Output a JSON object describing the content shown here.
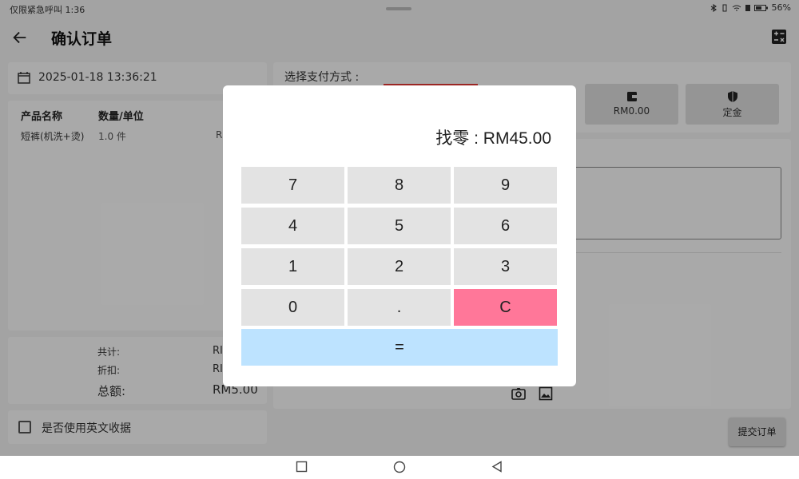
{
  "status_bar": {
    "left_text": "仅限紧急呼叫 1:36",
    "battery": "56%"
  },
  "app_bar": {
    "title": "确认订单",
    "icons": [
      "back-arrow-icon",
      "calculator-icon"
    ]
  },
  "order": {
    "datetime": "2025-01-18 13:36:21",
    "columns": [
      "产品名称",
      "数量/单位"
    ],
    "rows": [
      {
        "name": "短裤(机洗+烫)",
        "qty": "1.0 件",
        "price_fragment": "R"
      }
    ],
    "totals": [
      {
        "label": "共计:",
        "value": "RI"
      },
      {
        "label": "折扣:",
        "value": "RI"
      },
      {
        "label": "总额:",
        "value": "RM5.00"
      }
    ],
    "english_receipt_label": "是否使用英文收据"
  },
  "payment": {
    "title": "选择支付方式 :",
    "options": [
      {
        "label": "RM0.00",
        "icon": "wallet-icon"
      },
      {
        "label": "定金",
        "icon": "shield-icon"
      }
    ]
  },
  "submit_label": "提交订单",
  "calculator": {
    "change_text": "找零 : RM45.00",
    "keys": [
      "7",
      "8",
      "9",
      "4",
      "5",
      "6",
      "1",
      "2",
      "3",
      "0",
      ".",
      "C"
    ],
    "equals": "=",
    "colors": {
      "key": "#e3e3e3",
      "clear": "#ff7799",
      "equals": "#bde3ff"
    }
  }
}
